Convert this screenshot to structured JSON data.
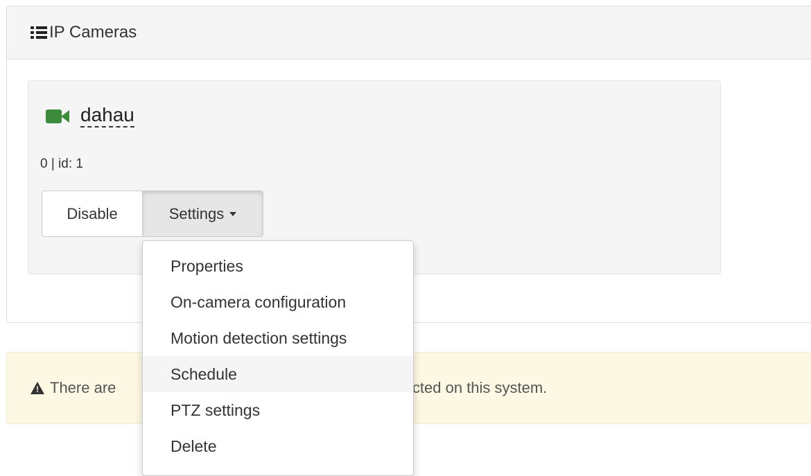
{
  "panel": {
    "title": "IP Cameras",
    "icon": "list-icon"
  },
  "camera": {
    "name": "dahau",
    "meta": "0 | id: 1",
    "icon": "video-camera-icon",
    "icon_color": "#3c8a3c"
  },
  "buttons": {
    "disable_label": "Disable",
    "settings_label": "Settings"
  },
  "dropdown": {
    "items": [
      {
        "label": "Properties"
      },
      {
        "label": "On-camera configuration"
      },
      {
        "label": "Motion detection settings"
      },
      {
        "label": "Schedule",
        "hovered": true
      },
      {
        "label": "PTZ settings"
      },
      {
        "label": "Delete"
      }
    ]
  },
  "alert": {
    "text_before": "There are",
    "text_after": "rds detected on this system.",
    "icon": "warning-icon",
    "background": "#fcf8e3"
  }
}
